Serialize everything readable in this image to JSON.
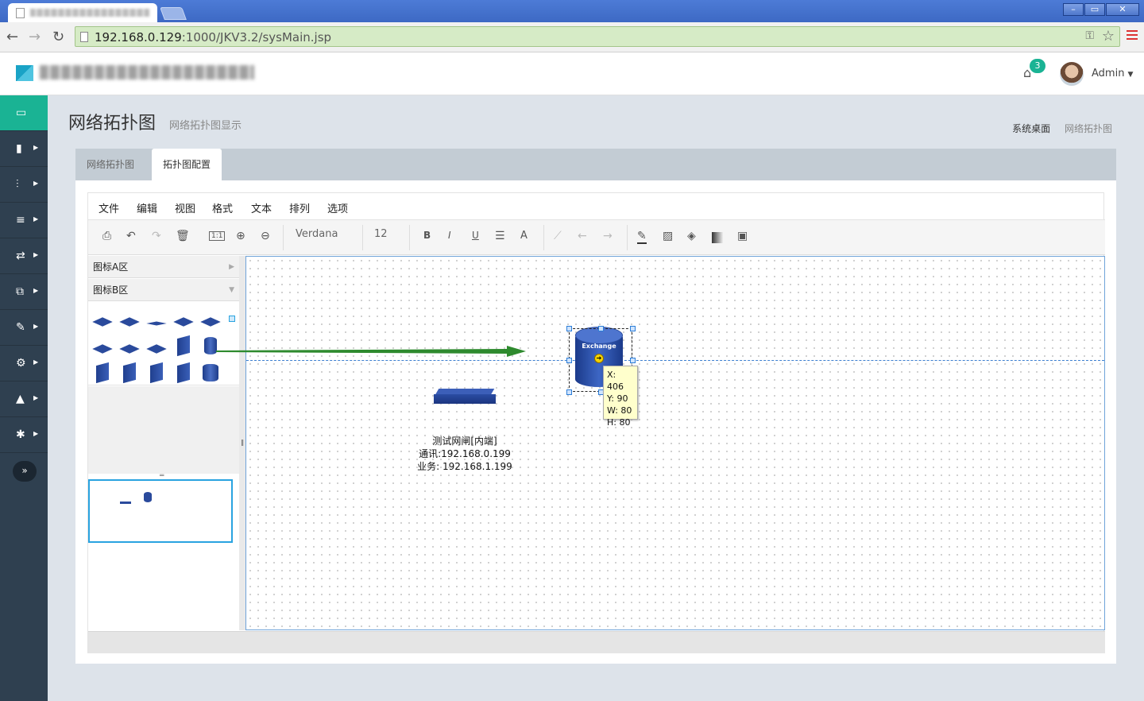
{
  "browser": {
    "url_host": "192.168.0.129",
    "url_path": ":1000/JKV3.2/sysMain.jsp",
    "window_buttons": [
      "–",
      "▭",
      "✕"
    ]
  },
  "header": {
    "notification_count": "3",
    "user_name": "Admin"
  },
  "sidebar": {
    "items": [
      {
        "icon": "laptop-icon",
        "glyph": "💻"
      },
      {
        "icon": "briefcase-icon",
        "glyph": "▮"
      },
      {
        "icon": "sliders-icon",
        "glyph": "⫶"
      },
      {
        "icon": "database-icon",
        "glyph": "≡"
      },
      {
        "icon": "exchange-icon",
        "glyph": "⇄"
      },
      {
        "icon": "copy-icon",
        "glyph": "⧉"
      },
      {
        "icon": "tools-icon",
        "glyph": "✎"
      },
      {
        "icon": "cogs-icon",
        "glyph": "⚙"
      },
      {
        "icon": "warning-icon",
        "glyph": "▲"
      },
      {
        "icon": "gear-icon",
        "glyph": "✱"
      }
    ],
    "collapse_glyph": "»"
  },
  "page": {
    "title": "网络拓扑图",
    "subtitle": "网络拓扑图显示",
    "breadcrumb": [
      "系统桌面",
      "网络拓扑图"
    ]
  },
  "tabs": [
    {
      "label": "网络拓扑图",
      "active": false
    },
    {
      "label": "拓扑图配置",
      "active": true
    }
  ],
  "editor": {
    "menu": [
      "文件",
      "编辑",
      "视图",
      "格式",
      "文本",
      "排列",
      "选项"
    ],
    "font_family": "Verdana",
    "font_size": "12",
    "toolbar_text": {
      "bold": "B",
      "italic": "I",
      "underline": "U",
      "fontcolor": "A",
      "actual_size": "1:1"
    },
    "palette_sections": [
      {
        "label": "图标A区",
        "expanded": false
      },
      {
        "label": "图标B区",
        "expanded": true
      }
    ],
    "canvas": {
      "gateway_label_lines": [
        "测试网闸[内端]",
        "通讯:192.168.0.199",
        "业务: 192.168.1.199"
      ],
      "exchange_label": "Exchange",
      "tooltip": [
        "X: 406",
        "Y: 90",
        "W: 80",
        "H: 80"
      ]
    },
    "colors": {
      "arrow": "#2e8a2e",
      "selection": "#2d7ed8",
      "accent": "#1ab394",
      "sidebar": "#2f4050"
    }
  }
}
